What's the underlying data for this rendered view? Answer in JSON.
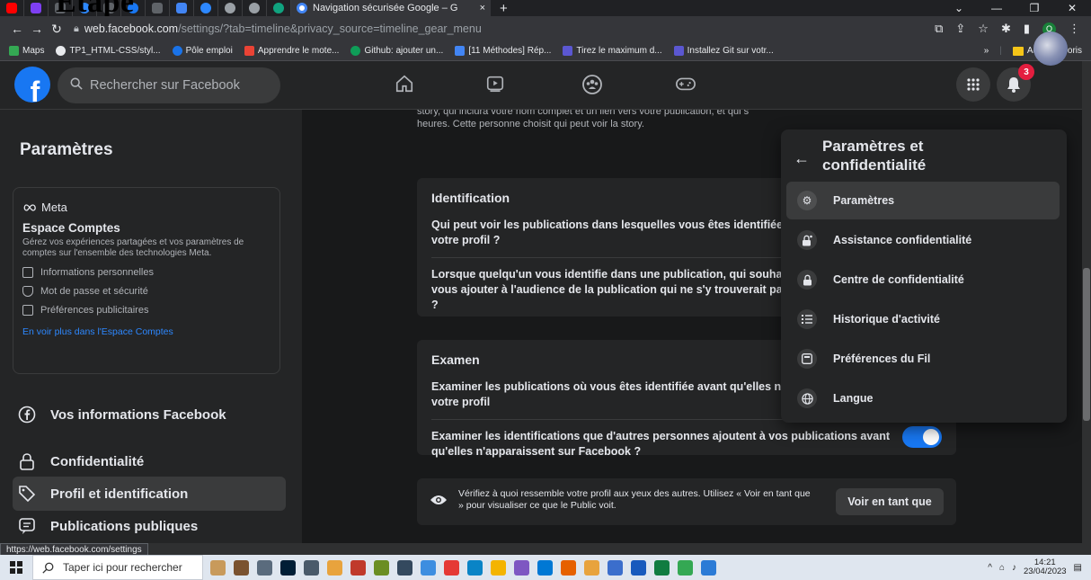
{
  "overlay_heading": "Etape",
  "browser": {
    "active_tab_title": "Navigation sécurisée Google – G",
    "tab_close": "×",
    "new_tab": "+",
    "window_controls": [
      "⌄",
      "—",
      "❐",
      "✕"
    ],
    "url_domain": "web.facebook.com",
    "url_path": "/settings/?tab=timeline&privacy_source=timeline_gear_menu",
    "status_url": "https://web.facebook.com/settings",
    "profile_letter": "O",
    "bookmarks": [
      {
        "label": "Maps",
        "color": "#34a853"
      },
      {
        "label": "TP1_HTML-CSS/styl...",
        "color": "#e8eaed"
      },
      {
        "label": "Pôle emploi",
        "color": "#1a73e8"
      },
      {
        "label": "Apprendre le mote...",
        "color": "#ea4335"
      },
      {
        "label": "Github: ajouter un...",
        "color": "#0f9d58"
      },
      {
        "label": "[11 Méthodes] Rép...",
        "color": "#4285f4"
      },
      {
        "label": "Tirez le maximum d...",
        "color": "#5b57d1"
      },
      {
        "label": "Installez Git sur votr...",
        "color": "#5b57d1"
      }
    ],
    "bookmarks_more": "»",
    "other_bookmarks": "Autres favoris"
  },
  "facebook": {
    "logo_letter": "f",
    "search_placeholder": "Rechercher sur Facebook",
    "notification_count": "3",
    "sidebar": {
      "title": "Paramètres",
      "meta": {
        "logo": "Meta",
        "title": "Espace Comptes",
        "description": "Gérez vos expériences partagées et vos paramètres de comptes sur l'ensemble des technologies Meta.",
        "items": [
          "Informations personnelles",
          "Mot de passe et sécurité",
          "Préférences publicitaires"
        ],
        "link": "En voir plus dans l'Espace Comptes"
      },
      "items": [
        {
          "label": "Vos informations Facebook",
          "icon": "facebook-circle-icon"
        },
        {
          "label": "Confidentialité",
          "icon": "lock-icon"
        },
        {
          "label": "Profil et identification",
          "icon": "tag-icon"
        },
        {
          "label": "Publications publiques",
          "icon": "feed-icon"
        }
      ]
    },
    "main": {
      "story_text": "story, qui inclura votre nom complet et un lien vers votre publication, et qui s heures. Cette personne choisit qui peut voir la story.",
      "identification": {
        "title": "Identification",
        "q1": "Qui peut voir les publications dans lesquelles vous êtes identifiée votre profil ?",
        "q2": "Lorsque quelqu'un vous identifie dans une publication, qui souha vous ajouter à l'audience de la publication qui ne s'y trouverait pa déjà ?"
      },
      "examen": {
        "title": "Examen",
        "q1": "Examiner les publications où vous êtes identifiée avant qu'elles n' votre profil",
        "q2": "Examiner les identifications que d'autres personnes ajoutent à vos publications avant qu'elles n'apparaissent sur Facebook ?",
        "toggle_on": true
      },
      "view_as": {
        "text": "Vérifiez à quoi ressemble votre profil aux yeux des autres. Utilisez « Voir en tant que » pour visualiser ce que le Public voit.",
        "button": "Voir en tant que"
      }
    },
    "dropdown": {
      "title": "Paramètres et confidentialité",
      "items": [
        {
          "label": "Paramètres",
          "icon": "gear-icon",
          "selected": true
        },
        {
          "label": "Assistance confidentialité",
          "icon": "lock-star-icon",
          "selected": false
        },
        {
          "label": "Centre de confidentialité",
          "icon": "lock-icon",
          "selected": false
        },
        {
          "label": "Historique d'activité",
          "icon": "list-icon",
          "selected": false
        },
        {
          "label": "Préférences du Fil",
          "icon": "feed-icon",
          "selected": false
        },
        {
          "label": "Langue",
          "icon": "globe-icon",
          "selected": false
        }
      ]
    }
  },
  "taskbar": {
    "search_placeholder": "Taper ici pour rechercher",
    "time": "14:21",
    "date": "23/04/2023",
    "app_colors": [
      "#c89a5b",
      "#7a5230",
      "#5a6b7d",
      "#001e36",
      "#4a5a6a",
      "#e8a33d",
      "#c0392b",
      "#6b8e23",
      "#34495e",
      "#3d8ee0",
      "#e53935",
      "#0a84c6",
      "#f4b400",
      "#7e57c2",
      "#0078d4",
      "#e66000",
      "#e8a33d",
      "#3b6ecc",
      "#185abd",
      "#107c41",
      "#34a853",
      "#2b7bd6"
    ]
  }
}
